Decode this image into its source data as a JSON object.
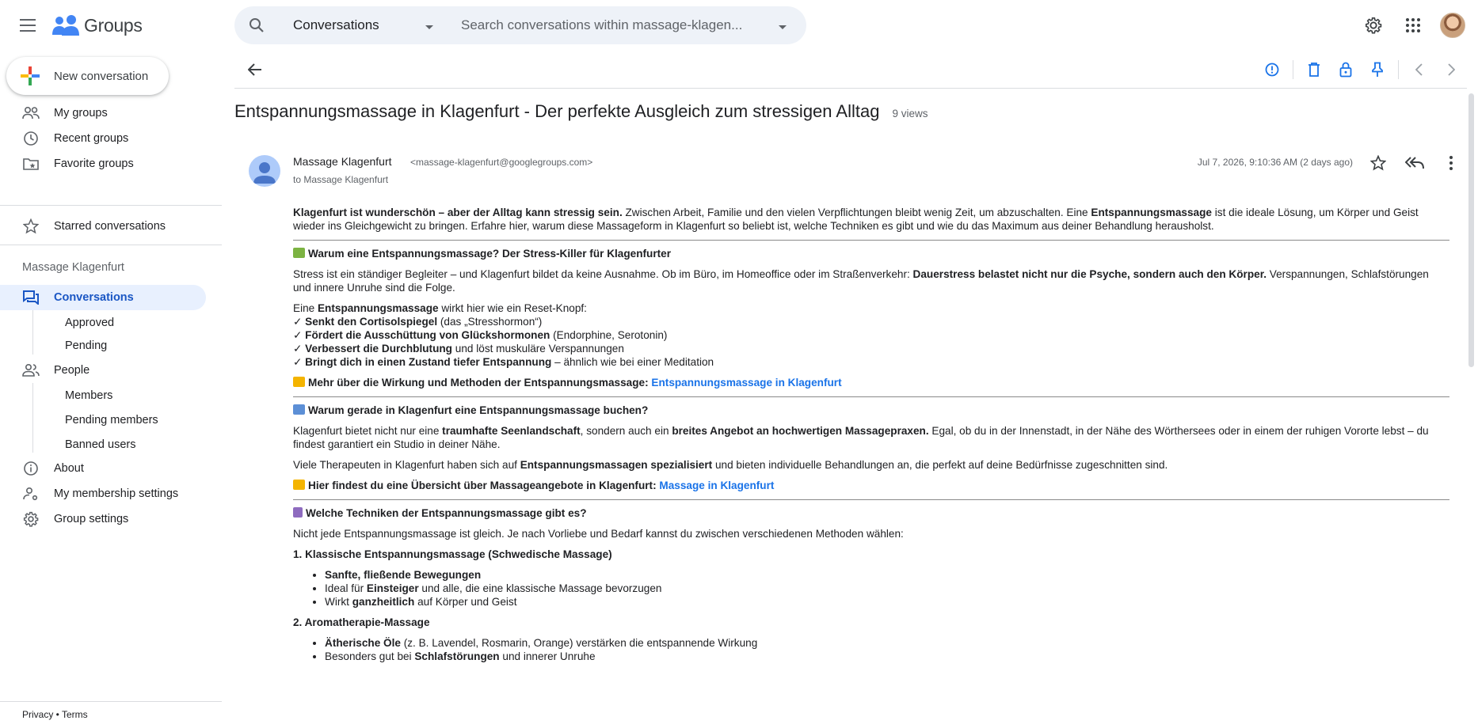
{
  "app": {
    "name": "Groups"
  },
  "search": {
    "scope": "Conversations",
    "placeholder": "Search conversations within massage-klagen..."
  },
  "sidebar": {
    "new_conversation": "New conversation",
    "items": [
      {
        "label": "My groups",
        "icon": "people-icon"
      },
      {
        "label": "Recent groups",
        "icon": "clock-icon"
      },
      {
        "label": "Favorite groups",
        "icon": "folder-star-icon"
      }
    ],
    "starred": "Starred conversations",
    "group_name": "Massage Klagenfurt",
    "conversations": "Conversations",
    "conversations_sub": [
      "Approved",
      "Pending"
    ],
    "people": "People",
    "people_sub": [
      "Members",
      "Pending members",
      "Banned users"
    ],
    "about": "About",
    "membership": "My membership settings",
    "group_settings": "Group settings",
    "footer_privacy": "Privacy",
    "footer_sep": " • ",
    "footer_terms": "Terms"
  },
  "thread": {
    "title": "Entspannungsmassage in Klagenfurt - Der perfekte Ausgleich zum stressigen Alltag",
    "views": "9 views",
    "sender": "Massage Klagenfurt",
    "sender_email": "<massage-klagenfurt@googlegroups.com>",
    "to": "to Massage Klagenfurt",
    "date": "Jul 7, 2026, 9:10:36 AM (2 days ago)"
  },
  "body": {
    "intro_b1": "Klagenfurt ist wunderschön – aber der Alltag kann stressig sein.",
    "intro_t1": " Zwischen Arbeit, Familie und den vielen Verpflichtungen bleibt wenig Zeit, um abzuschalten. Eine ",
    "intro_b2": "Entspannungsmassage",
    "intro_t2": " ist die ideale Lösung, um Körper und Geist wieder ins Gleichgewicht zu bringen. Erfahre hier, warum diese Massageform in Klagenfurt so beliebt ist, welche Techniken es gibt und wie du das Maximum aus deiner Behandlung herausholst.",
    "h1": "Warum eine Entspannungsmassage? Der Stress-Killer für Klagenfurter",
    "p1_t1": "Stress ist ein ständiger Begleiter – und Klagenfurt bildet da keine Ausnahme. Ob im Büro, im Homeoffice oder im Straßenverkehr: ",
    "p1_b1": "Dauerstress belastet nicht nur die Psyche, sondern auch den Körper.",
    "p1_t2": " Verspannungen, Schlafstörungen und innere Unruhe sind die Folge.",
    "p2_t1": "Eine ",
    "p2_b1": "Entspannungsmassage",
    "p2_t2": " wirkt hier wie ein Reset-Knopf:",
    "checks": [
      {
        "b": "Senkt den Cortisolspiegel",
        "t": " (das „Stresshormon“)"
      },
      {
        "b": "Fördert die Ausschüttung von Glückshormonen",
        "t": " (Endorphine, Serotonin)"
      },
      {
        "b": "Verbessert die Durchblutung",
        "t": " und löst muskuläre Verspannungen"
      },
      {
        "b": "Bringt dich in einen Zustand tiefer Entspannung",
        "t": " – ähnlich wie bei einer Meditation"
      }
    ],
    "check_mark": "✓ ",
    "more1_b": "Mehr über die Wirkung und Methoden der Entspannungsmassage: ",
    "more1_link": "Entspannungsmassage in Klagenfurt",
    "h2": "Warum gerade in Klagenfurt eine Entspannungsmassage buchen?",
    "p3_t1": "Klagenfurt bietet nicht nur eine ",
    "p3_b1": "traumhafte Seenlandschaft",
    "p3_t2": ", sondern auch ein ",
    "p3_b2": "breites Angebot an hochwertigen Massagepraxen.",
    "p3_t3": " Egal, ob du in der Innenstadt, in der Nähe des Wörthersees oder in einem der ruhigen Vororte lebst – du findest garantiert ein Studio in deiner Nähe.",
    "p4_t1": "Viele Therapeuten in Klagenfurt haben sich auf ",
    "p4_b1": "Entspannungsmassagen spezialisiert",
    "p4_t2": " und bieten individuelle Behandlungen an, die perfekt auf deine Bedürfnisse zugeschnitten sind.",
    "more2_b": "Hier findest du eine Übersicht über Massageangebote in Klagenfurt: ",
    "more2_link": "Massage in Klagenfurt",
    "h3": "Welche Techniken der Entspannungsmassage gibt es?",
    "p5": "Nicht jede Entspannungsmassage ist gleich. Je nach Vorliebe und Bedarf kannst du zwischen verschiedenen Methoden wählen:",
    "s1": "1. Klassische Entspannungsmassage (Schwedische Massage)",
    "s1_items": [
      {
        "b": "Sanfte, fließende Bewegungen",
        "t": ""
      },
      {
        "t0": "Ideal für ",
        "b": "Einsteiger",
        "t": " und alle, die eine klassische Massage bevorzugen"
      },
      {
        "t0": "Wirkt ",
        "b": "ganzheitlich",
        "t": " auf Körper und Geist"
      }
    ],
    "s2": "2. Aromatherapie-Massage",
    "s2_items": [
      {
        "t0": "",
        "b": "Ätherische Öle",
        "t": " (z. B. Lavendel, Rosmarin, Orange) verstärken die entspannende Wirkung"
      },
      {
        "t0": "Besonders gut bei ",
        "b": "Schlafstörungen",
        "t": " und innerer Unruhe"
      }
    ]
  },
  "colors": {
    "accent": "#1a73e8",
    "active_bg": "#e8f0fe",
    "search_bg": "#eef2f8"
  }
}
